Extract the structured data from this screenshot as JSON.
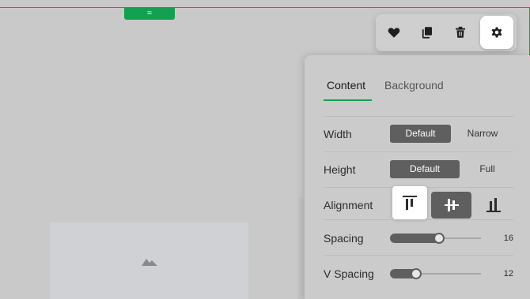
{
  "drag_handle": {
    "label": "="
  },
  "toolbar": {
    "buttons": [
      {
        "icon": "heart-icon",
        "active": false
      },
      {
        "icon": "copy-icon",
        "active": false
      },
      {
        "icon": "trash-icon",
        "active": false
      },
      {
        "icon": "gear-icon",
        "active": true
      }
    ]
  },
  "panel": {
    "tabs": [
      {
        "label": "Content",
        "selected": true
      },
      {
        "label": "Background",
        "selected": false
      }
    ],
    "width": {
      "label": "Width",
      "options": [
        "Default",
        "Narrow"
      ],
      "selected": "Default"
    },
    "height": {
      "label": "Height",
      "options": [
        "Default",
        "Full"
      ],
      "selected": "Default"
    },
    "alignment": {
      "label": "Alignment",
      "options": [
        "align-top-icon",
        "align-center-icon",
        "align-bottom-icon"
      ],
      "selected": "align-center-icon",
      "focused": "align-top-icon"
    },
    "spacing": {
      "label": "Spacing",
      "value": "16",
      "fraction": 0.5
    },
    "v_spacing": {
      "label": "V Spacing",
      "value": "12",
      "fraction": 0.25
    }
  },
  "colors": {
    "accent": "#12a150",
    "selected": "#5f5f5f",
    "panel": "#cbcbcb"
  }
}
